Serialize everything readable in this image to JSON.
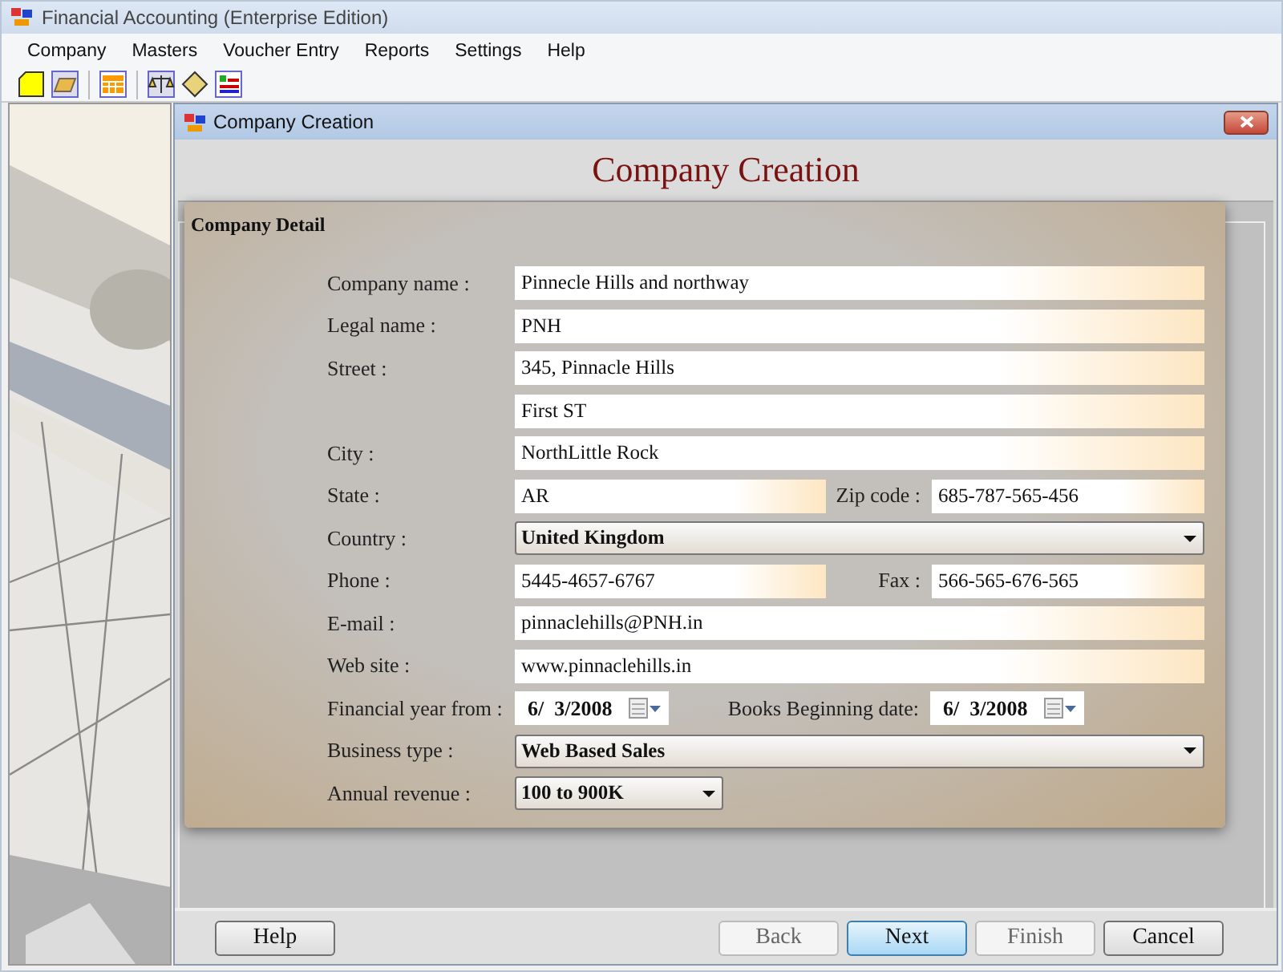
{
  "window": {
    "title": "Financial Accounting (Enterprise Edition)"
  },
  "menu": [
    "Company",
    "Masters",
    "Voucher Entry",
    "Reports",
    "Settings",
    "Help"
  ],
  "dialog": {
    "title": "Company Creation",
    "heading": "Company Creation",
    "group_title": "Company Detail"
  },
  "rows": [
    {
      "label": "Company name :",
      "kind": "text",
      "value": "Pinnecle Hills and northway"
    },
    {
      "label": "Legal name :",
      "kind": "text",
      "value": "PNH"
    },
    {
      "label": "Street :",
      "kind": "text",
      "value": "345, Pinnacle Hills"
    },
    {
      "kind": "text",
      "value": "First ST"
    },
    {
      "label": "City :",
      "kind": "text",
      "value": "NorthLittle Rock"
    },
    {
      "label": "State :",
      "kind": "text",
      "value": "AR",
      "second": {
        "label": "Zip code :",
        "kind": "text",
        "value": "685-787-565-456"
      }
    },
    {
      "label": "Country :",
      "kind": "select",
      "value": "United Kingdom"
    },
    {
      "label": "Phone :",
      "kind": "text",
      "value": "5445-4657-6767",
      "second": {
        "label": "Fax :",
        "kind": "text",
        "value": "566-565-676-565"
      }
    },
    {
      "label": "E-mail :",
      "kind": "text",
      "value": "pinnaclehills@PNH.in"
    },
    {
      "label": "Web site :",
      "kind": "text",
      "value": "www.pinnaclehills.in"
    },
    {
      "label": "Financial year from :",
      "kind": "date",
      "value": "6/  3/2008",
      "second": {
        "label": "Books Beginning date:",
        "kind": "date",
        "value": "6/  3/2008"
      }
    },
    {
      "label": "Business type :",
      "kind": "select",
      "value": "Web Based Sales"
    },
    {
      "label": "Annual revenue :",
      "kind": "short-select",
      "value": "100 to 900K"
    }
  ],
  "buttons": [
    {
      "label": "Help",
      "disabled": false,
      "default": false
    },
    {
      "label": "Back",
      "disabled": true,
      "default": false
    },
    {
      "label": "Next",
      "disabled": false,
      "default": true
    },
    {
      "label": "Finish",
      "disabled": true,
      "default": false
    },
    {
      "label": "Cancel",
      "disabled": false,
      "default": false
    }
  ]
}
